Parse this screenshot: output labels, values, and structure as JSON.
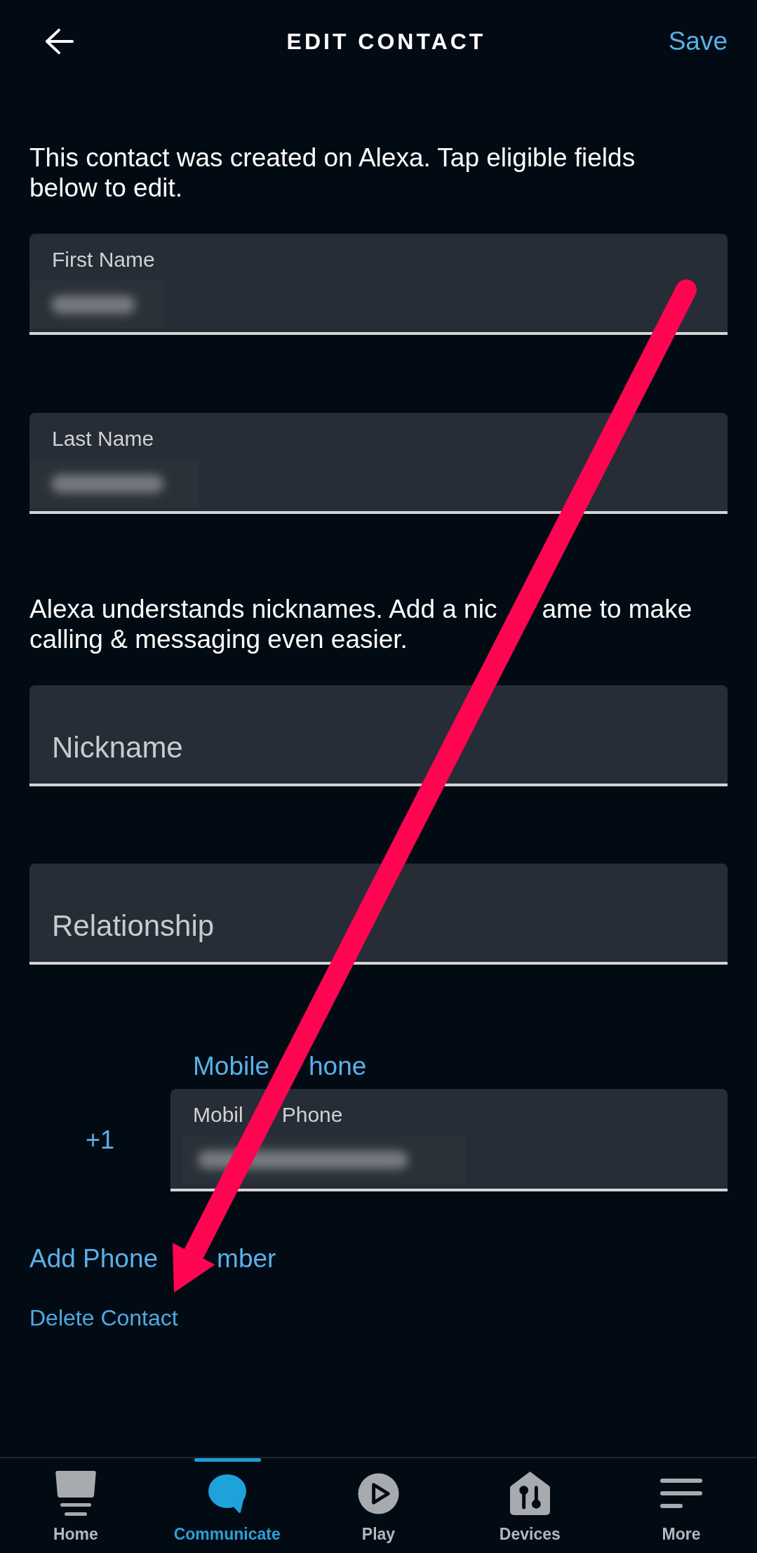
{
  "header": {
    "title": "EDIT CONTACT",
    "action": "Save"
  },
  "intro": "This contact was created on Alexa. Tap eligible fields below to edit.",
  "name_fields": [
    {
      "label": "First Name",
      "value_blurred": true
    },
    {
      "label": "Last Name",
      "value_blurred": true
    }
  ],
  "nickname_note": [
    "Alexa understands nicknames. Add a nic",
    "ame to make calling & messaging even easier."
  ],
  "detail_fields": [
    {
      "placeholder": "Nickname"
    },
    {
      "placeholder": "Relationship"
    }
  ],
  "phone": {
    "type_label": [
      "Mobile",
      "hone"
    ],
    "country_code": "+1",
    "field_label": [
      "Mobil",
      "Phone"
    ],
    "value_blurred": true
  },
  "add_phone": [
    "Add Phone",
    "mber"
  ],
  "delete_contact": "Delete Contact",
  "tab_bar": [
    {
      "label": "Home",
      "selected": false
    },
    {
      "label": "Communicate",
      "selected": true
    },
    {
      "label": "Play",
      "selected": false
    },
    {
      "label": "Devices",
      "selected": false
    },
    {
      "label": "More",
      "selected": false
    }
  ],
  "overlay": {
    "kind": "arrow"
  }
}
